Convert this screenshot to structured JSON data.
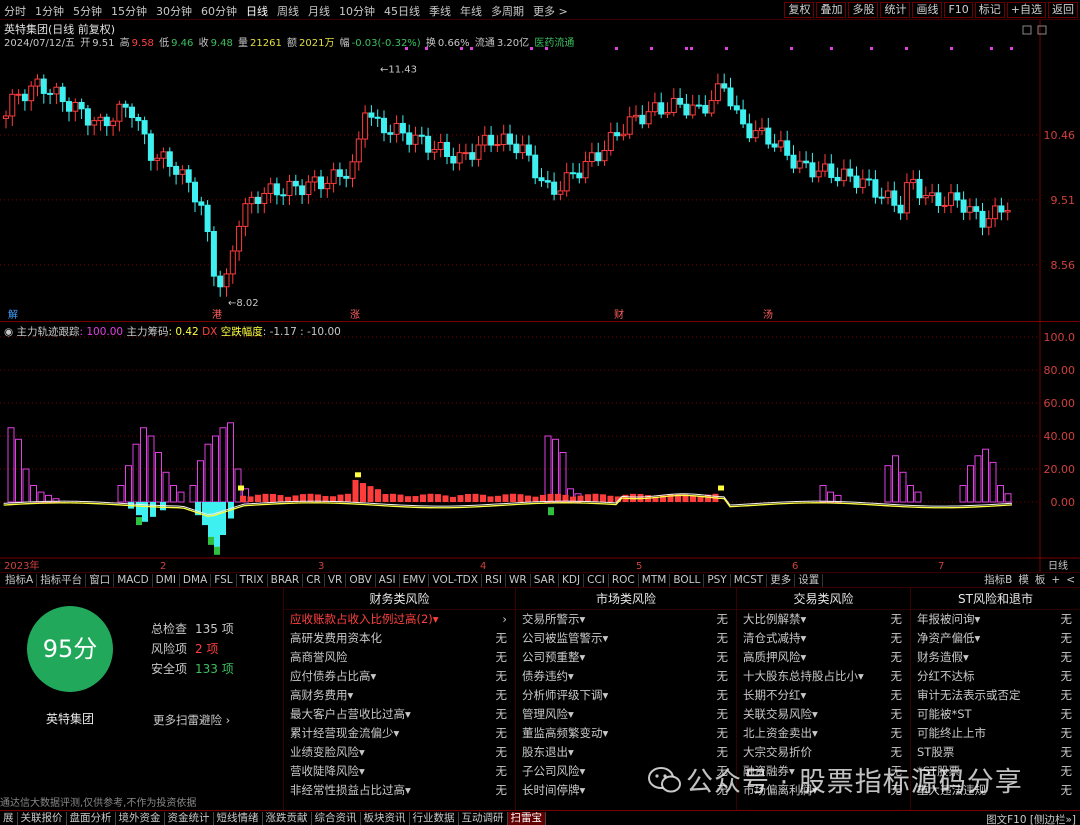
{
  "toolbar": {
    "periods": [
      "分时",
      "1分钟",
      "5分钟",
      "15分钟",
      "30分钟",
      "60分钟",
      "日线",
      "周线",
      "月线",
      "10分钟",
      "45日线",
      "季线",
      "年线",
      "多周期",
      "更多 >"
    ],
    "active_period": "日线",
    "right_buttons": [
      "复权",
      "叠加",
      "多股",
      "统计",
      "画线",
      "F10",
      "标记",
      "+自选",
      "返回"
    ]
  },
  "stock": {
    "title": "英特集团(日线 前复权)",
    "date": "2024/07/12/五",
    "open_label": "开",
    "open": "9.51",
    "high_label": "高",
    "high": "9.58",
    "low_label": "低",
    "low": "9.46",
    "close_label": "收",
    "close": "9.48",
    "volume_label": "量",
    "volume": "21261",
    "amount_label": "额",
    "amount": "2021万",
    "change_label": "幅",
    "change": "-0.03(-0.32%)",
    "turnover_label": "换",
    "turnover": "0.66%",
    "float_label": "流通",
    "float_cap": "3.20亿",
    "sector": "医药流通"
  },
  "main_chart": {
    "price_ticks": [
      "10.46",
      "9.51",
      "8.56"
    ],
    "annotations": {
      "high": "11.43",
      "low": "8.02"
    },
    "event_marks": [
      "解",
      "港",
      "涨",
      "财",
      "汤"
    ]
  },
  "indicator": {
    "name": "主力轨迹跟踪",
    "v1": ": 100.00",
    "name2": "主力筹码",
    "v2": ": 0.42",
    "dx": "DX",
    "name3": "空跌幅度",
    "v3": ": -1.17 : -10.00",
    "y_ticks": [
      "100.0",
      "80.00",
      "60.00",
      "40.00",
      "20.00",
      "0.00"
    ],
    "x_labels": [
      "2023年",
      "2",
      "3",
      "4",
      "5",
      "6",
      "7"
    ],
    "period_tag": "日线"
  },
  "indicator_tabs": {
    "tabs": [
      "指标A",
      "指标平台",
      "窗口",
      "MACD",
      "DMI",
      "DMA",
      "FSL",
      "TRIX",
      "BRAR",
      "CR",
      "VR",
      "OBV",
      "ASI",
      "EMV",
      "VOL-TDX",
      "RSI",
      "WR",
      "SAR",
      "KDJ",
      "CCI",
      "ROC",
      "MTM",
      "BOLL",
      "PSY",
      "MCST",
      "更多",
      "设置"
    ],
    "right": [
      "指标B",
      "模",
      "板",
      "+",
      "<"
    ]
  },
  "risk": {
    "score": "95分",
    "company": "英特集团",
    "stats": [
      {
        "label": "总检查",
        "value": "135 项",
        "color": "#c8c8c8"
      },
      {
        "label": "风险项",
        "value": "2 项",
        "color": "#ff4040"
      },
      {
        "label": "安全项",
        "value": "133 项",
        "color": "#3cc060"
      }
    ],
    "more_scan": "更多扫雷避险 ›",
    "columns": [
      {
        "title": "财务类风险",
        "items": [
          {
            "label": "应收账款占收入比例过高(2)▾",
            "status": "›",
            "warn": true
          },
          {
            "label": "高研发费用资本化",
            "status": "无"
          },
          {
            "label": "高商誉风险",
            "status": "无"
          },
          {
            "label": "应付债券占比高▾",
            "status": "无"
          },
          {
            "label": "高财务费用▾",
            "status": "无"
          },
          {
            "label": "最大客户占营收比过高▾",
            "status": "无"
          },
          {
            "label": "累计经营现金流偏少▾",
            "status": "无"
          },
          {
            "label": "业绩变脸风险▾",
            "status": "无"
          },
          {
            "label": "营收陡降风险▾",
            "status": "无"
          },
          {
            "label": "非经常性损益占比过高▾",
            "status": "无"
          }
        ]
      },
      {
        "title": "市场类风险",
        "items": [
          {
            "label": "交易所警示▾",
            "status": "无"
          },
          {
            "label": "公司被监管警示▾",
            "status": "无"
          },
          {
            "label": "公司预重整▾",
            "status": "无"
          },
          {
            "label": "债券违约▾",
            "status": "无"
          },
          {
            "label": "分析师评级下调▾",
            "status": "无"
          },
          {
            "label": "管理风险▾",
            "status": "无"
          },
          {
            "label": "董监高频繁变动▾",
            "status": "无"
          },
          {
            "label": "股东退出▾",
            "status": "无"
          },
          {
            "label": "子公司风险▾",
            "status": "无"
          },
          {
            "label": "长时间停牌▾",
            "status": "无"
          }
        ]
      },
      {
        "title": "交易类风险",
        "items": [
          {
            "label": "大比例解禁▾",
            "status": "无"
          },
          {
            "label": "清仓式减持▾",
            "status": "无"
          },
          {
            "label": "高质押风险▾",
            "status": "无"
          },
          {
            "label": "十大股东总持股占比小▾",
            "status": "无"
          },
          {
            "label": "长期不分红▾",
            "status": "无"
          },
          {
            "label": "关联交易风险▾",
            "status": "无"
          },
          {
            "label": "北上资金卖出▾",
            "status": "无"
          },
          {
            "label": "大宗交易折价",
            "status": "无"
          },
          {
            "label": "融资融券▾",
            "status": "无"
          },
          {
            "label": "市场偏离利润▾",
            "status": "无"
          }
        ]
      },
      {
        "title": "ST风险和退市",
        "items": [
          {
            "label": "年报被问询▾",
            "status": "无"
          },
          {
            "label": "净资产偏低▾",
            "status": "无"
          },
          {
            "label": "财务造假▾",
            "status": "无"
          },
          {
            "label": "分红不达标",
            "status": "无"
          },
          {
            "label": "审计无法表示或否定",
            "status": "无"
          },
          {
            "label": "可能被*ST",
            "status": "无"
          },
          {
            "label": "可能终止上市",
            "status": "无"
          },
          {
            "label": "ST股票",
            "status": "无"
          },
          {
            "label": "*ST股票",
            "status": "无"
          },
          {
            "label": "重大违法违规",
            "status": "无"
          }
        ]
      }
    ]
  },
  "disclaimer": "通达信大数据评测,仅供参考,不作为投资依据",
  "watermark": "公众号 · 股票指标源码分享",
  "bottom_tabs": [
    "展",
    "关联报价",
    "盘面分析",
    "境外资金",
    "资金统计",
    "短线情绪",
    "涨跌贡献",
    "综合资讯",
    "板块资讯",
    "行业数据",
    "互动调研",
    "扫雷宝"
  ],
  "bottom_active": "扫雷宝",
  "bottom_right": "图文F10 [侧边栏»]",
  "colors": {
    "up": "#ff3c3c",
    "down": "#3ff0f0",
    "magenta": "#e040e0",
    "yellow": "#ffff40",
    "green": "#30c040",
    "grid": "#7a0000"
  }
}
